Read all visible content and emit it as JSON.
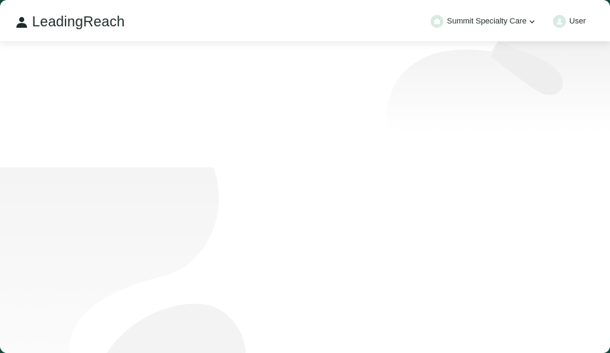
{
  "header": {
    "brand": "LeadingReach",
    "organization": "Summit Specialty Care",
    "user_label": "User"
  },
  "icons": {
    "logo": "person-icon",
    "org": "building-icon",
    "user": "user-icon",
    "chevron": "chevron-down-icon"
  },
  "colors": {
    "background_outer": "#0f4a3c",
    "avatar_bg": "#d6ebe2",
    "text": "#1f2a2a"
  }
}
